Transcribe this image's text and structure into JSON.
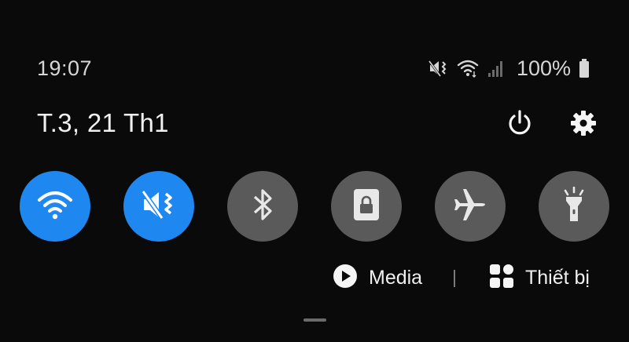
{
  "status_bar": {
    "time": "19:07",
    "battery_percent": "100%",
    "icons": [
      "vibrate-icon",
      "wifi-icon",
      "signal-icon",
      "battery-icon"
    ]
  },
  "header": {
    "date": "T.3, 21 Th1",
    "icons": [
      "power-icon",
      "settings-icon"
    ]
  },
  "quick_tiles": [
    {
      "name": "wifi",
      "icon": "wifi-icon",
      "state": "on"
    },
    {
      "name": "sound-vibrate",
      "icon": "vibrate-icon",
      "state": "on"
    },
    {
      "name": "bluetooth",
      "icon": "bluetooth-icon",
      "state": "off"
    },
    {
      "name": "screen-lock",
      "icon": "lock-icon",
      "state": "off"
    },
    {
      "name": "airplane-mode",
      "icon": "airplane-icon",
      "state": "off"
    },
    {
      "name": "flashlight",
      "icon": "flashlight-icon",
      "state": "off"
    }
  ],
  "bottom": {
    "media_label": "Media",
    "devices_label": "Thiết bị"
  },
  "colors": {
    "background": "#0a0a0a",
    "tile_on": "#1e88f0",
    "tile_off": "#5a5a5a",
    "text": "#f0f0f0"
  }
}
